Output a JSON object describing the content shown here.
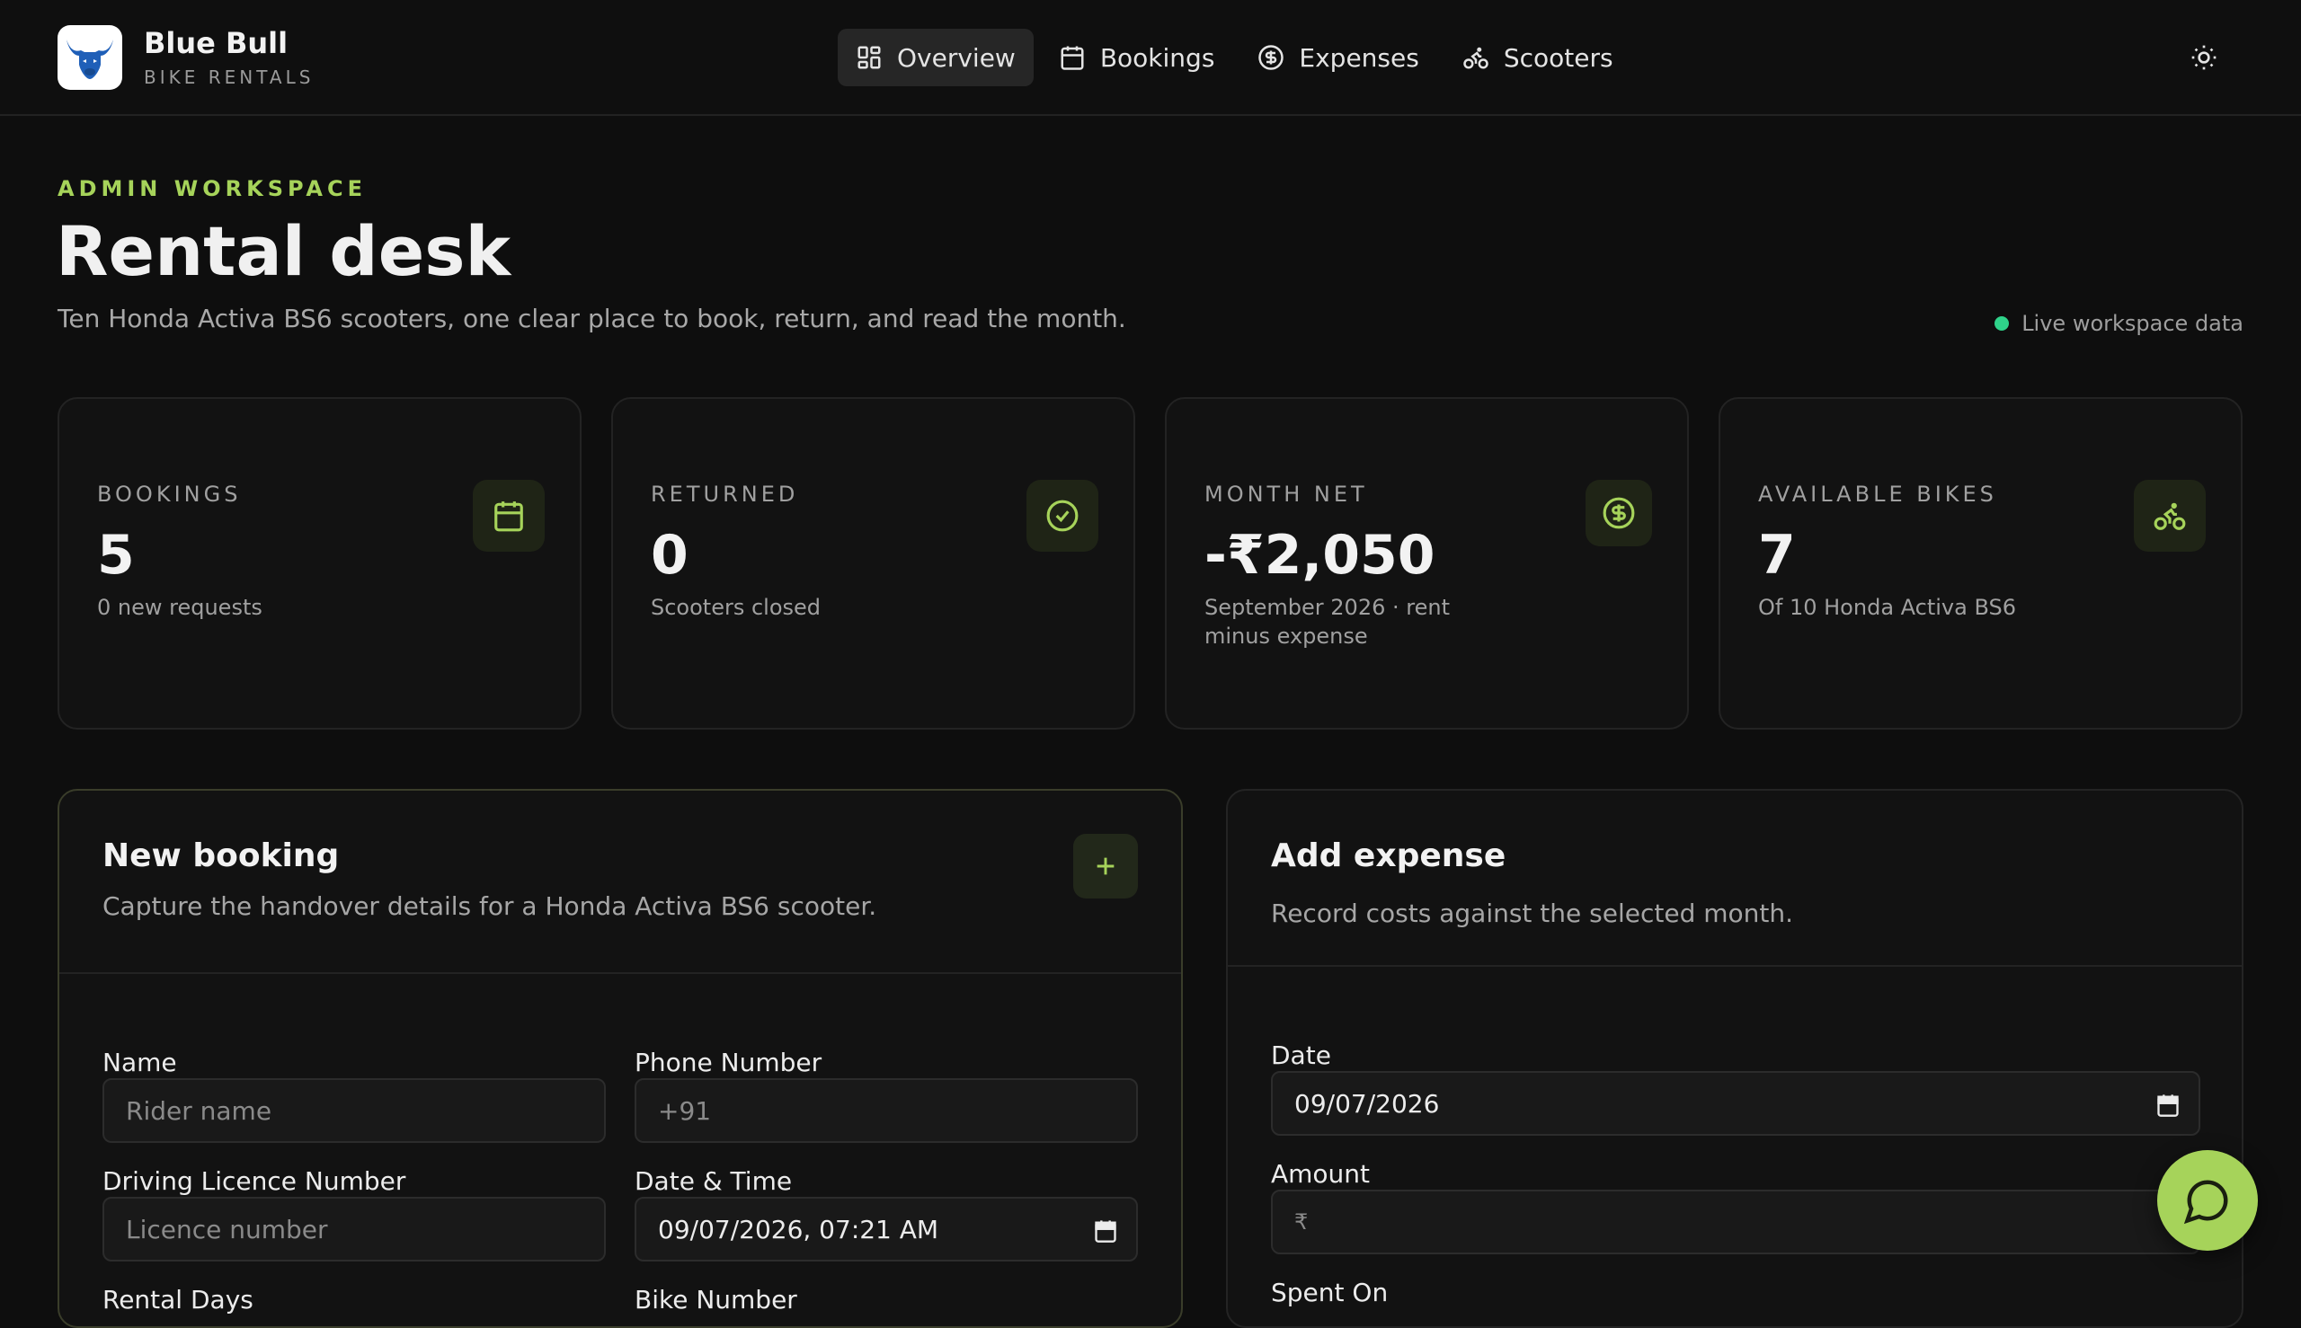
{
  "brand": {
    "name": "Blue Bull",
    "subtitle": "BIKE RENTALS"
  },
  "nav": [
    {
      "label": "Overview",
      "icon": "grid-icon",
      "active": true
    },
    {
      "label": "Bookings",
      "icon": "calendar-icon",
      "active": false
    },
    {
      "label": "Expenses",
      "icon": "dollar-circle-icon",
      "active": false
    },
    {
      "label": "Scooters",
      "icon": "bike-icon",
      "active": false
    }
  ],
  "hero": {
    "eyebrow": "ADMIN WORKSPACE",
    "title": "Rental desk",
    "subtitle": "Ten Honda Activa BS6 scooters, one clear place to book, return, and read the month.",
    "live_label": "Live workspace data"
  },
  "stats": [
    {
      "label": "BOOKINGS",
      "value": "5",
      "note": "0 new requests",
      "icon": "calendar-icon"
    },
    {
      "label": "RETURNED",
      "value": "0",
      "note": "Scooters closed",
      "icon": "check-circle-icon"
    },
    {
      "label": "MONTH NET",
      "value": "-₹2,050",
      "note": "September 2026 · rent minus expense",
      "icon": "dollar-circle-icon"
    },
    {
      "label": "AVAILABLE BIKES",
      "value": "7",
      "note": "Of 10 Honda Activa BS6",
      "icon": "bike-icon"
    }
  ],
  "booking": {
    "title": "New booking",
    "description": "Capture the handover details for a Honda Activa BS6 scooter.",
    "fields": {
      "name_label": "Name",
      "name_placeholder": "Rider name",
      "phone_label": "Phone Number",
      "phone_placeholder": "+91",
      "licence_label": "Driving Licence Number",
      "licence_placeholder": "Licence number",
      "datetime_label": "Date & Time",
      "datetime_value": "09/07/2026, 07:21 AM",
      "rental_days_label": "Rental Days",
      "bike_number_label": "Bike Number"
    }
  },
  "expense": {
    "title": "Add expense",
    "description": "Record costs against the selected month.",
    "fields": {
      "date_label": "Date",
      "date_value": "09/07/2026",
      "amount_label": "Amount",
      "amount_placeholder": "₹",
      "spent_on_label": "Spent On"
    }
  },
  "colors": {
    "accent": "#a6d35a",
    "live": "#2fd38a",
    "background": "#0e0e0e"
  }
}
